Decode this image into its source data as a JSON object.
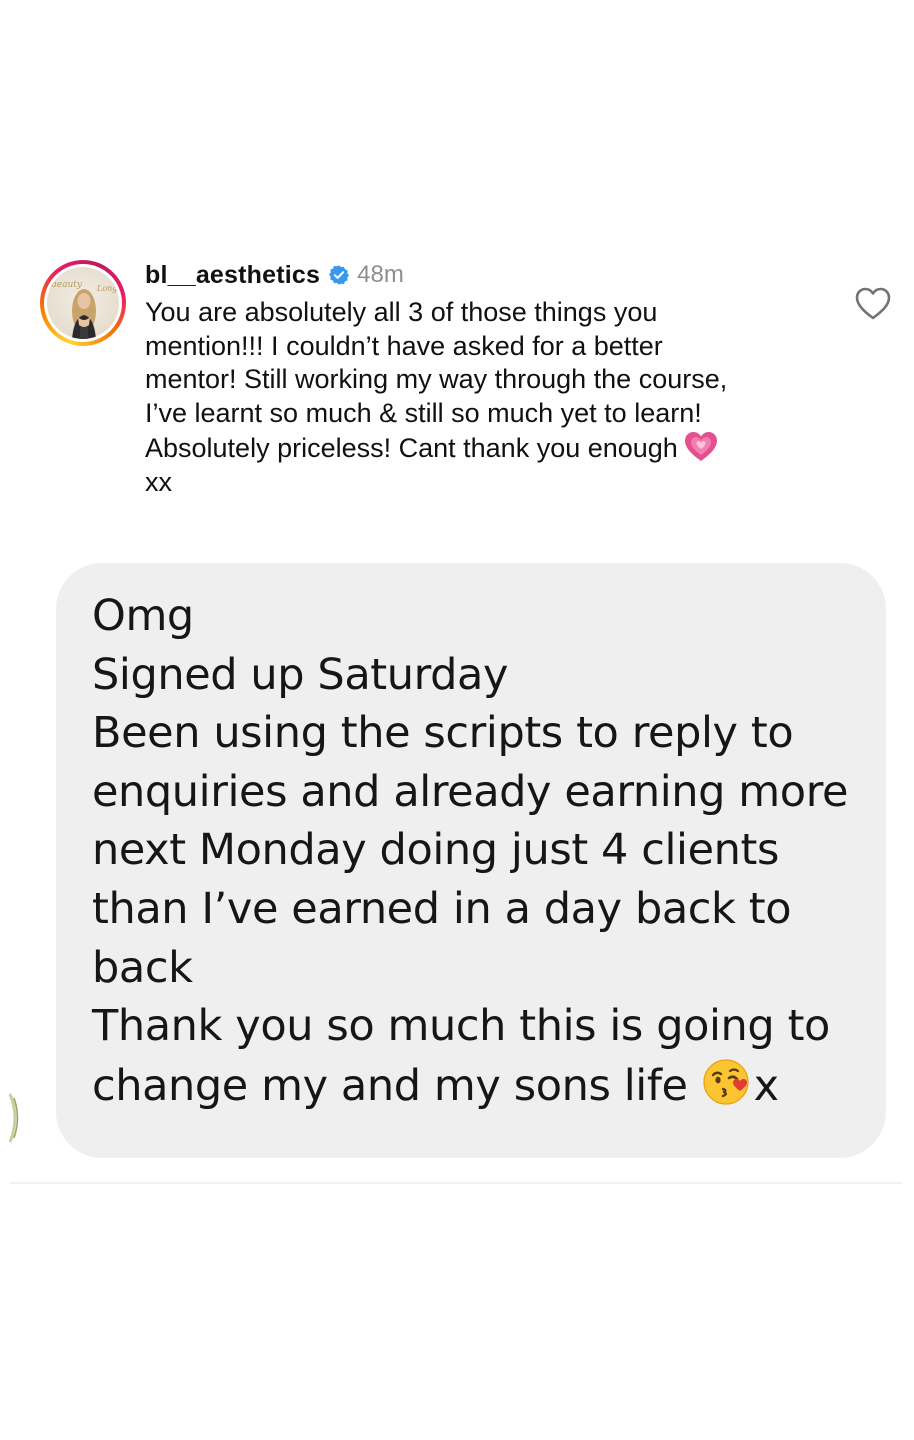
{
  "comment": {
    "username": "bl__aesthetics",
    "verified_icon": "verified-badge-icon",
    "time": "48m",
    "text_lines": [
      "You are absolutely all 3 of those things you",
      "mention!!! I couldn’t have asked for a better",
      "mentor! Still working my way through the course,",
      "I’ve learnt so much & still so much yet to learn!",
      "Absolutely priceless! Cant thank you enough"
    ],
    "text_last_line": "xx",
    "emoji": "growing-heart-icon",
    "like_icon": "heart-outline-icon"
  },
  "message": {
    "lines": [
      "Omg",
      "Signed up Saturday",
      "Been using the scripts to reply to",
      "enquiries and already earning more",
      "next Monday doing just 4 clients",
      "than I’ve earned in a day back to",
      "back",
      "Thank you so much this is going to"
    ],
    "last_line": "change my and my sons life",
    "last_line_suffix": "x",
    "emoji": "kissing-face-icon"
  },
  "colors": {
    "bubble_bg": "#efefef",
    "verified_blue": "#3897f0",
    "muted_text": "#8e8e8e",
    "heart_pink": "#e4508f"
  }
}
